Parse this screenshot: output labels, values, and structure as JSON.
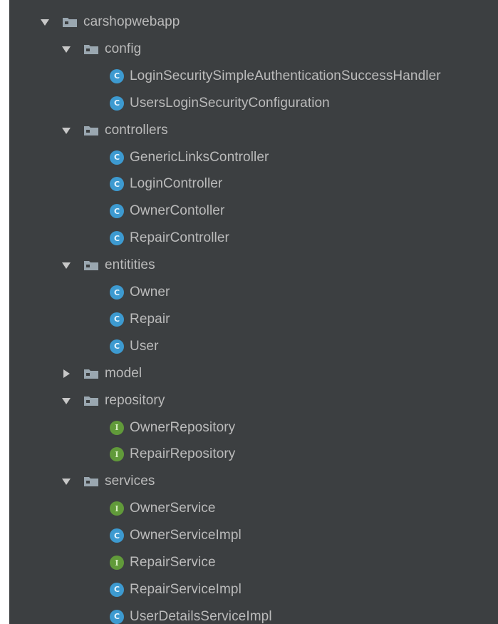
{
  "project_tree": {
    "root": {
      "label": "carshopwebapp",
      "expanded": true,
      "icon": "folder-icon"
    },
    "packages": [
      {
        "label": "config",
        "expanded": true,
        "children": [
          {
            "label": "LoginSecuritySimpleAuthenticationSuccessHandler",
            "kind": "class"
          },
          {
            "label": "UsersLoginSecurityConfiguration",
            "kind": "class"
          }
        ]
      },
      {
        "label": "controllers",
        "expanded": true,
        "children": [
          {
            "label": "GenericLinksController",
            "kind": "class"
          },
          {
            "label": "LoginController",
            "kind": "class"
          },
          {
            "label": "OwnerContoller",
            "kind": "class"
          },
          {
            "label": "RepairController",
            "kind": "class"
          }
        ]
      },
      {
        "label": "entitities",
        "expanded": true,
        "children": [
          {
            "label": "Owner",
            "kind": "class"
          },
          {
            "label": "Repair",
            "kind": "class"
          },
          {
            "label": "User",
            "kind": "class"
          }
        ]
      },
      {
        "label": "model",
        "expanded": false,
        "children": []
      },
      {
        "label": "repository",
        "expanded": true,
        "children": [
          {
            "label": "OwnerRepository",
            "kind": "interface"
          },
          {
            "label": "RepairRepository",
            "kind": "interface"
          }
        ]
      },
      {
        "label": "services",
        "expanded": true,
        "children": [
          {
            "label": "OwnerService",
            "kind": "interface"
          },
          {
            "label": "OwnerServiceImpl",
            "kind": "class"
          },
          {
            "label": "RepairService",
            "kind": "interface"
          },
          {
            "label": "RepairServiceImpl",
            "kind": "class"
          },
          {
            "label": "UserDetailsServiceImpl",
            "kind": "class"
          }
        ]
      }
    ],
    "badge_letters": {
      "class": "C",
      "interface": "I"
    },
    "colors": {
      "background": "#3c3f41",
      "text": "#bbbbbb",
      "class_badge": "#3d9ad0",
      "interface_badge": "#619a3a",
      "folder": "#9aa7b0",
      "arrow": "#c8c8c8"
    }
  }
}
